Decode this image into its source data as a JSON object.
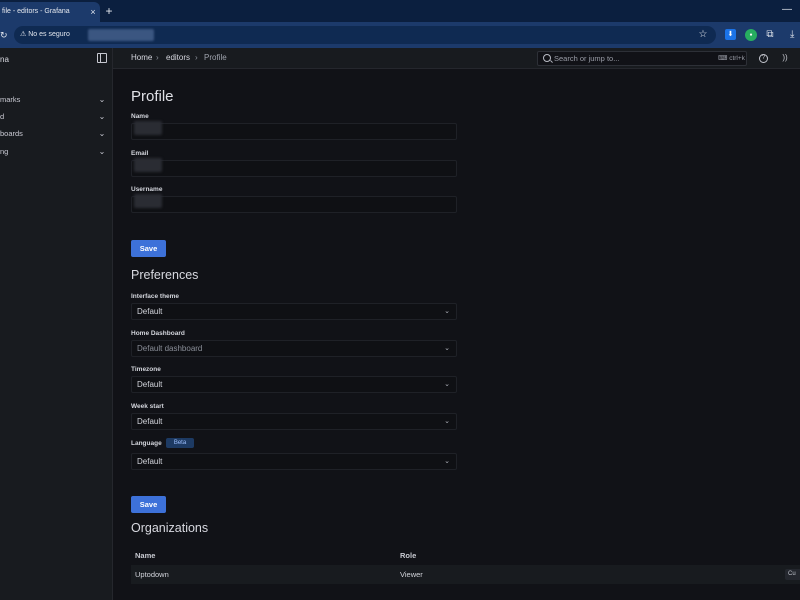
{
  "browser": {
    "tab_title": "file - editors - Grafana",
    "tab_close": "×",
    "new_tab": "+",
    "security_label": "⚠ No es seguro",
    "minimize": "—",
    "reload": "↻",
    "star": "☆",
    "download": "⤓"
  },
  "sidebar": {
    "brand": "na",
    "items": [
      {
        "label": "marks"
      },
      {
        "label": "d"
      },
      {
        "label": "boards"
      },
      {
        "label": "ng"
      }
    ],
    "chevron": "⌄"
  },
  "topbar": {
    "breadcrumbs": [
      "Home",
      "editors",
      "Profile"
    ],
    "separator": "›",
    "search_placeholder": "Search or jump to...",
    "shortcut": "⌨ ctrl+k"
  },
  "profile": {
    "title": "Profile",
    "name_label": "Name",
    "email_label": "Email",
    "username_label": "Username",
    "save_label": "Save"
  },
  "preferences": {
    "title": "Preferences",
    "interface_theme_label": "Interface theme",
    "interface_theme_value": "Default",
    "home_dashboard_label": "Home Dashboard",
    "home_dashboard_placeholder": "Default dashboard",
    "timezone_label": "Timezone",
    "timezone_value": "Default",
    "week_start_label": "Week start",
    "week_start_value": "Default",
    "language_label": "Language",
    "beta_badge": "Beta",
    "language_value": "Default",
    "save_label": "Save",
    "chevron": "⌄"
  },
  "organizations": {
    "title": "Organizations",
    "columns": [
      "Name",
      "Role"
    ],
    "rows": [
      {
        "name": "Uptodown",
        "role": "Viewer",
        "action": "Cu"
      }
    ]
  },
  "colors": {
    "accent": "#3d71d9",
    "background": "#111217",
    "panel": "#181b1f"
  }
}
